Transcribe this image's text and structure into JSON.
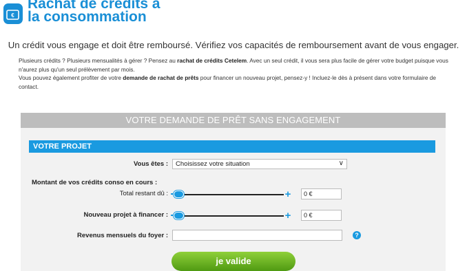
{
  "header": {
    "title_line1": "Rachat de crédits à",
    "title_line2": "la consommation",
    "logo_icon": "wallet-icon",
    "brand_color": "#1a8fd6"
  },
  "tagline": "Un crédit vous engage et doit être remboursé. Vérifiez vos capacités de remboursement avant de vous engager.",
  "intro": {
    "p1_a": "Plusieurs crédits ? Plusieurs mensualités à gérer ? Pensez au ",
    "p1_bold": "rachat de crédits Cetelem",
    "p1_b": ". Avec un seul crédit, il vous sera plus facile de gérer votre budget puisque vous n'aurez plus qu'un seul prélèvement par mois.",
    "p2_a": "Vous pouvez également profiter de votre ",
    "p2_bold": "demande de rachat de prêts",
    "p2_b": " pour financer un nouveau projet, pensez-y ! Incluez-le dès à présent dans votre formulaire de contact."
  },
  "form": {
    "header": "VOTRE DEMANDE DE PRÊT SANS ENGAGEMENT",
    "section_title": "VOTRE PROJET",
    "situation_label": "Vous êtes :",
    "situation_value": "Choisissez votre situation",
    "montant_label": "Montant de vos crédits conso en cours :",
    "total_label": "Total restant dû :",
    "total_value": "0 €",
    "total_slider_level": 0,
    "projet_label": "Nouveau projet à financer :",
    "projet_value": "0 €",
    "projet_slider_level": 0,
    "revenus_label": "Revenus mensuels du foyer :",
    "revenus_value": "",
    "help_icon": "?",
    "submit_label": "je valide",
    "accent_color": "#1a9ae0",
    "submit_color": "#6bb823"
  }
}
